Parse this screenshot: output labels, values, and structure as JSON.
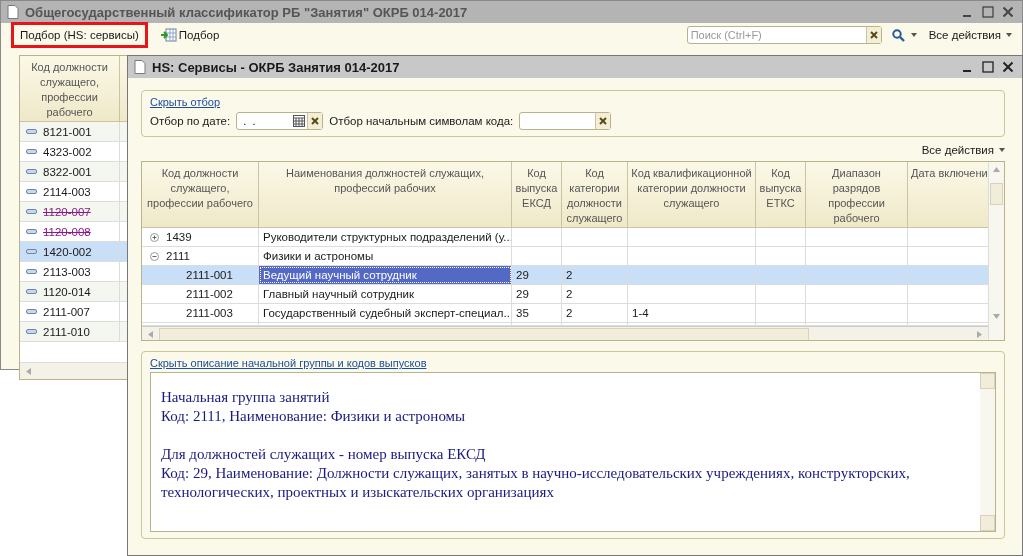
{
  "main_window": {
    "title": "Общегосударственный классификатор РБ \"Занятия\" ОКРБ 014-2017",
    "toolbar": [
      {
        "kind": "text",
        "label": "Подбор (HS: сервисы)",
        "highlighted": true
      },
      {
        "kind": "icon",
        "label": "Подбор",
        "highlighted": false
      }
    ],
    "search": {
      "placeholder": "Поиск (Ctrl+F)"
    },
    "all_actions": "Все действия",
    "list": {
      "column": "Код должности служащего, профессии рабочего",
      "rows": [
        {
          "code": "8121-001",
          "deleted": false,
          "selected": false
        },
        {
          "code": "4323-002",
          "deleted": false,
          "selected": false
        },
        {
          "code": "8322-001",
          "deleted": false,
          "selected": false
        },
        {
          "code": "2114-003",
          "deleted": false,
          "selected": false
        },
        {
          "code": "1120-007",
          "deleted": true,
          "selected": false
        },
        {
          "code": "1120-008",
          "deleted": true,
          "selected": false
        },
        {
          "code": "1420-002",
          "deleted": false,
          "selected": true
        },
        {
          "code": "2113-003",
          "deleted": false,
          "selected": false
        },
        {
          "code": "1120-014",
          "deleted": false,
          "selected": false
        },
        {
          "code": "2111-007",
          "deleted": false,
          "selected": false
        },
        {
          "code": "2111-010",
          "deleted": false,
          "selected": false
        }
      ]
    }
  },
  "dialog": {
    "title": "HS: Сервисы - ОКРБ Занятия 014-2017",
    "filter": {
      "toggle_link": "Скрыть отбор",
      "date_label": "Отбор по дате:",
      "date_value": " .  .",
      "code_label": "Отбор начальным символам кода:"
    },
    "all_actions": "Все действия",
    "table": {
      "columns": [
        "Код должности служащего, профессии рабочего",
        "Наименования должностей служащих, профессий рабочих",
        "Код выпуска ЕКСД",
        "Код категории должности служащего",
        "Код квалификационной категории должности служащего",
        "Код выпуска ЕТКС",
        "Диапазон разрядов профессии рабочего",
        "Дата включени"
      ],
      "rows": [
        {
          "kind": "group",
          "expanded": false,
          "code": "1439",
          "name": "Руководители структурных подразделений (у...",
          "selected": false
        },
        {
          "kind": "group",
          "expanded": true,
          "code": "2111",
          "name": "Физики и астрономы",
          "selected": false
        },
        {
          "kind": "item",
          "code": "2111-001",
          "name": "Ведущий научный сотрудник",
          "ecsd": "29",
          "category": "2",
          "selected": true
        },
        {
          "kind": "item",
          "code": "2111-002",
          "name": "Главный научный сотрудник",
          "ecsd": "29",
          "category": "2",
          "selected": false
        },
        {
          "kind": "item",
          "code": "2111-003",
          "name": "Государственный судебный эксперт-специал...",
          "ecsd": "35",
          "category": "2",
          "qualification": "1-4",
          "selected": false
        }
      ]
    },
    "description": {
      "toggle_link": "Скрыть описание начальной группы и кодов выпусков",
      "paragraphs": [
        [
          "Начальная группа занятий",
          "Код: 2111, Наименование: Физики и астрономы"
        ],
        [
          "Для должностей служащих - номер выпуска ЕКСД",
          "Код: 29, Наименование: Должности служащих, занятых в научно-исследовательских учреждениях, конструкторских, технологических, проектных и изыскательских организациях"
        ]
      ]
    }
  }
}
